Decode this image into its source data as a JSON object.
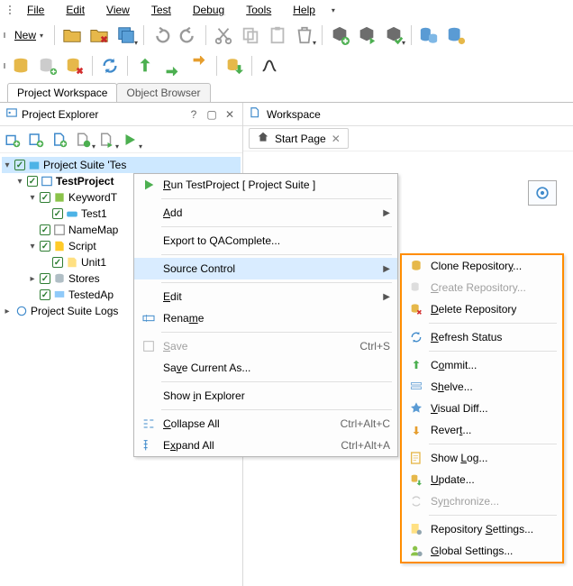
{
  "menubar": {
    "items": [
      "File",
      "Edit",
      "View",
      "Test",
      "Debug",
      "Tools",
      "Help"
    ]
  },
  "toolbars": {
    "new_label": "New"
  },
  "tabs": {
    "workspace": "Project Workspace",
    "object_browser": "Object Browser"
  },
  "project_explorer": {
    "title": "Project Explorer",
    "help": "?",
    "opts": "�ment",
    "close": "✕"
  },
  "tree": {
    "suite": "Project Suite 'Tes",
    "project": "TestProject",
    "kw": "KeywordT",
    "test1": "Test1",
    "nm": "NameMap",
    "script": "Script",
    "unit1": "Unit1",
    "stores": "Stores",
    "tested": "TestedAp",
    "logs": "Project Suite Logs"
  },
  "workspace": {
    "title": "Workspace",
    "start_page": "Start Page",
    "close": "✕"
  },
  "context_main": {
    "run": "Run TestProject  [ Project Suite ]",
    "add": "Add",
    "export": "Export to QAComplete...",
    "source_control": "Source Control",
    "edit": "Edit",
    "rename": "Rename",
    "save": "Save",
    "save_sc": "Ctrl+S",
    "save_as": "Save Current As...",
    "show_explorer": "Show in Explorer",
    "collapse": "Collapse All",
    "collapse_sc": "Ctrl+Alt+C",
    "expand": "Expand All",
    "expand_sc": "Ctrl+Alt+A"
  },
  "context_sc": {
    "clone": "Clone Repository...",
    "create": "Create Repository...",
    "delete": "Delete Repository",
    "refresh": "Refresh Status",
    "commit": "Commit...",
    "shelve": "Shelve...",
    "vdiff": "Visual Diff...",
    "revert": "Revert...",
    "showlog": "Show Log...",
    "update": "Update...",
    "sync": "Synchronize...",
    "repo_settings": "Repository Settings...",
    "global_settings": "Global Settings..."
  }
}
